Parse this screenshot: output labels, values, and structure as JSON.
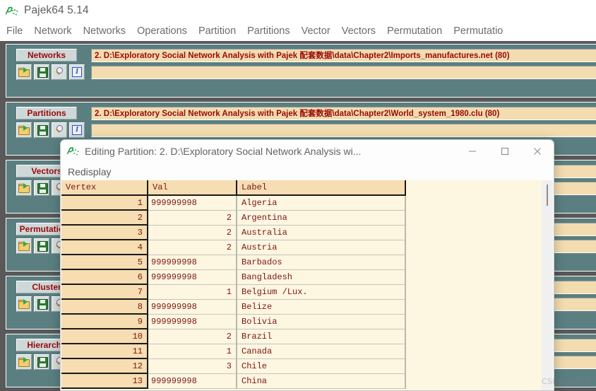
{
  "window": {
    "title": "Pajek64 5.14",
    "icon": "pajek-app-icon"
  },
  "menubar": {
    "items": [
      "File",
      "Network",
      "Networks",
      "Operations",
      "Partition",
      "Partitions",
      "Vector",
      "Vectors",
      "Permutation",
      "Permutatio"
    ]
  },
  "tools": {
    "open_title": "Read",
    "save_title": "Save",
    "view_title": "View/Edit",
    "info_title": "Info"
  },
  "panels": [
    {
      "id": "networks",
      "label": "Networks",
      "fields": [
        {
          "pre": "2. D:\\Exploratory Social Network Analysis with Pajek ",
          "cjk": "配套数据",
          "post": "\\data\\Chapter2\\Imports_manufactures.net (80)"
        },
        {
          "pre": "",
          "cjk": "",
          "post": ""
        }
      ]
    },
    {
      "id": "partitions",
      "label": "Partitions",
      "fields": [
        {
          "pre": "2. D:\\Exploratory Social Network Analysis with Pajek ",
          "cjk": "配套数据",
          "post": "\\data\\Chapter2\\World_system_1980.clu (80)"
        },
        {
          "pre": "",
          "cjk": "",
          "post": ""
        }
      ]
    },
    {
      "id": "vectors",
      "label": "Vectors",
      "fields": [
        {
          "pre": "",
          "cjk": "",
          "post": ""
        },
        {
          "pre": "",
          "cjk": "",
          "post": ""
        }
      ]
    },
    {
      "id": "permutations",
      "label": "Permutations",
      "fields": [
        {
          "pre": "",
          "cjk": "",
          "post": ""
        },
        {
          "pre": "",
          "cjk": "",
          "post": ""
        }
      ]
    },
    {
      "id": "cluster",
      "label": "Cluster",
      "fields": [
        {
          "pre": "",
          "cjk": "",
          "post": ""
        },
        {
          "pre": "",
          "cjk": "",
          "post": ""
        }
      ]
    },
    {
      "id": "hierarchy",
      "label": "Hierarchy",
      "fields": [
        {
          "pre": "",
          "cjk": "",
          "post": ""
        },
        {
          "pre": "",
          "cjk": "",
          "post": ""
        }
      ]
    }
  ],
  "dialog": {
    "title": "Editing Partition: 2. D:\\Exploratory Social Network Analysis wi...",
    "icon": "pajek-app-icon",
    "controls": {
      "minimize": "minimize-icon",
      "maximize": "maximize-icon",
      "close": "close-icon"
    },
    "menu": {
      "redisplay": "Redisplay"
    },
    "table": {
      "columns": [
        "Vertex",
        "Val",
        "Label"
      ],
      "rows": [
        {
          "vertex": "1",
          "val": "999999998",
          "label": "Algeria"
        },
        {
          "vertex": "2",
          "val": "2",
          "label": "Argentina"
        },
        {
          "vertex": "3",
          "val": "2",
          "label": "Australia"
        },
        {
          "vertex": "4",
          "val": "2",
          "label": "Austria"
        },
        {
          "vertex": "5",
          "val": "999999998",
          "label": "Barbados"
        },
        {
          "vertex": "6",
          "val": "999999998",
          "label": "Bangladesh"
        },
        {
          "vertex": "7",
          "val": "1",
          "label": "Belgium /Lux."
        },
        {
          "vertex": "8",
          "val": "999999998",
          "label": "Belize"
        },
        {
          "vertex": "9",
          "val": "999999998",
          "label": "Bolivia"
        },
        {
          "vertex": "10",
          "val": "2",
          "label": "Brazil"
        },
        {
          "vertex": "11",
          "val": "1",
          "label": "Canada"
        },
        {
          "vertex": "12",
          "val": "3",
          "label": "Chile"
        },
        {
          "vertex": "13",
          "val": "999999998",
          "label": "China"
        }
      ]
    }
  },
  "watermark": {
    "text": "CSDN @陈士"
  },
  "colors": {
    "panel_bg": "#5b7f80",
    "panel_label_bg": "#cfd8d8",
    "field_bg": "#f2dcb0",
    "field_text": "#9a0808",
    "header_bg": "#f6ddb2",
    "row_bg": "#fdf6e0",
    "table_text": "#7d1414",
    "client_bg": "#595959"
  }
}
